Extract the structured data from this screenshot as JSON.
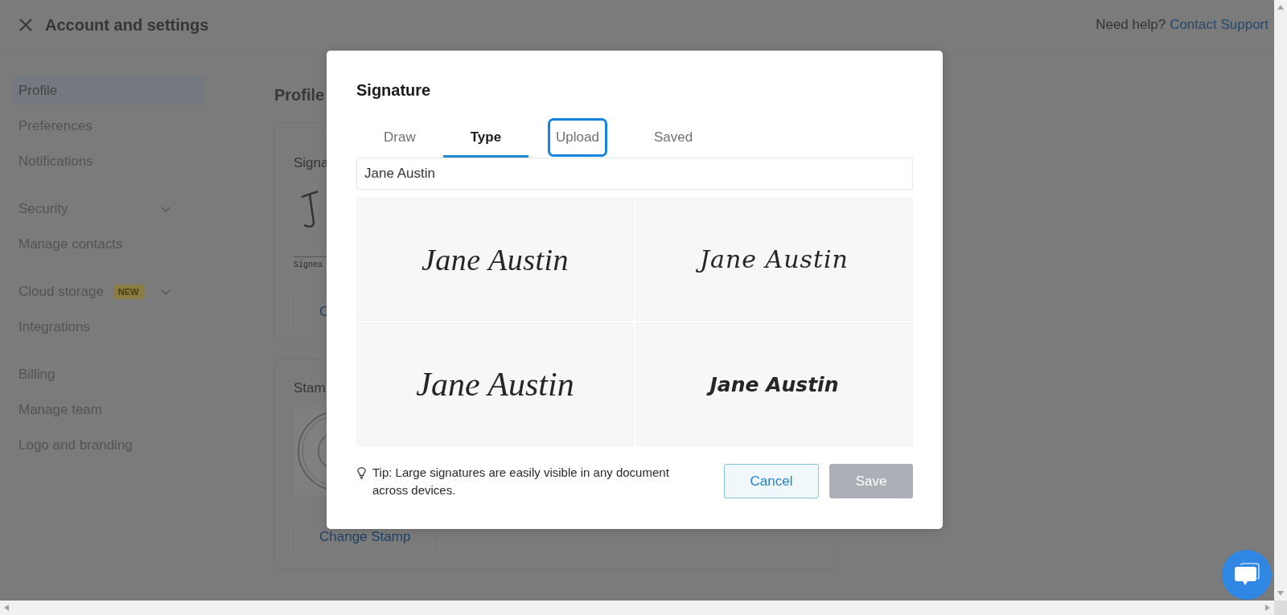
{
  "header": {
    "title": "Account and settings",
    "help_text": "Need help?",
    "help_link": "Contact Support"
  },
  "sidebar": {
    "groups": [
      {
        "items": [
          {
            "label": "Profile",
            "selected": true,
            "kind": "link"
          },
          {
            "label": "Preferences",
            "selected": false,
            "kind": "link"
          },
          {
            "label": "Notifications",
            "selected": false,
            "kind": "link"
          }
        ]
      },
      {
        "items": [
          {
            "label": "Security",
            "selected": false,
            "kind": "expandable"
          },
          {
            "label": "Manage contacts",
            "selected": false,
            "kind": "link"
          }
        ]
      },
      {
        "items": [
          {
            "label": "Cloud storage",
            "selected": false,
            "kind": "expandable",
            "badge": "NEW"
          },
          {
            "label": "Integrations",
            "selected": false,
            "kind": "link"
          }
        ]
      },
      {
        "items": [
          {
            "label": "Billing",
            "selected": false,
            "kind": "link"
          },
          {
            "label": "Manage team",
            "selected": false,
            "kind": "link"
          },
          {
            "label": "Logo and branding",
            "selected": false,
            "kind": "link"
          }
        ]
      }
    ]
  },
  "content": {
    "heading": "Profile",
    "cards": [
      {
        "kind": "signature",
        "label": "Signa",
        "caption": "Signea",
        "button": "C"
      },
      {
        "kind": "stamp",
        "label": "Stam",
        "button": "Change Stamp"
      }
    ]
  },
  "dialog": {
    "title": "Signature",
    "tabs": [
      {
        "label": "Draw",
        "selected": false,
        "focused": false
      },
      {
        "label": "Type",
        "selected": true,
        "focused": false
      },
      {
        "label": "Upload",
        "selected": false,
        "focused": true
      },
      {
        "label": "Saved",
        "selected": false,
        "focused": false
      }
    ],
    "name_field": {
      "value": "Jane Austin"
    },
    "signature_options": [
      {
        "text": "Jane Austin",
        "selected": false
      },
      {
        "text": "Jane Austin",
        "selected": false
      },
      {
        "text": "Jane Austin",
        "selected": false
      },
      {
        "text": "Jane Austin",
        "selected": false
      }
    ],
    "tip": "Tip: Large signatures are easily visible in any document across devices.",
    "buttons": [
      {
        "label": "Cancel",
        "kind": "secondary",
        "disabled": false
      },
      {
        "label": "Save",
        "kind": "primary",
        "disabled": true
      }
    ]
  }
}
